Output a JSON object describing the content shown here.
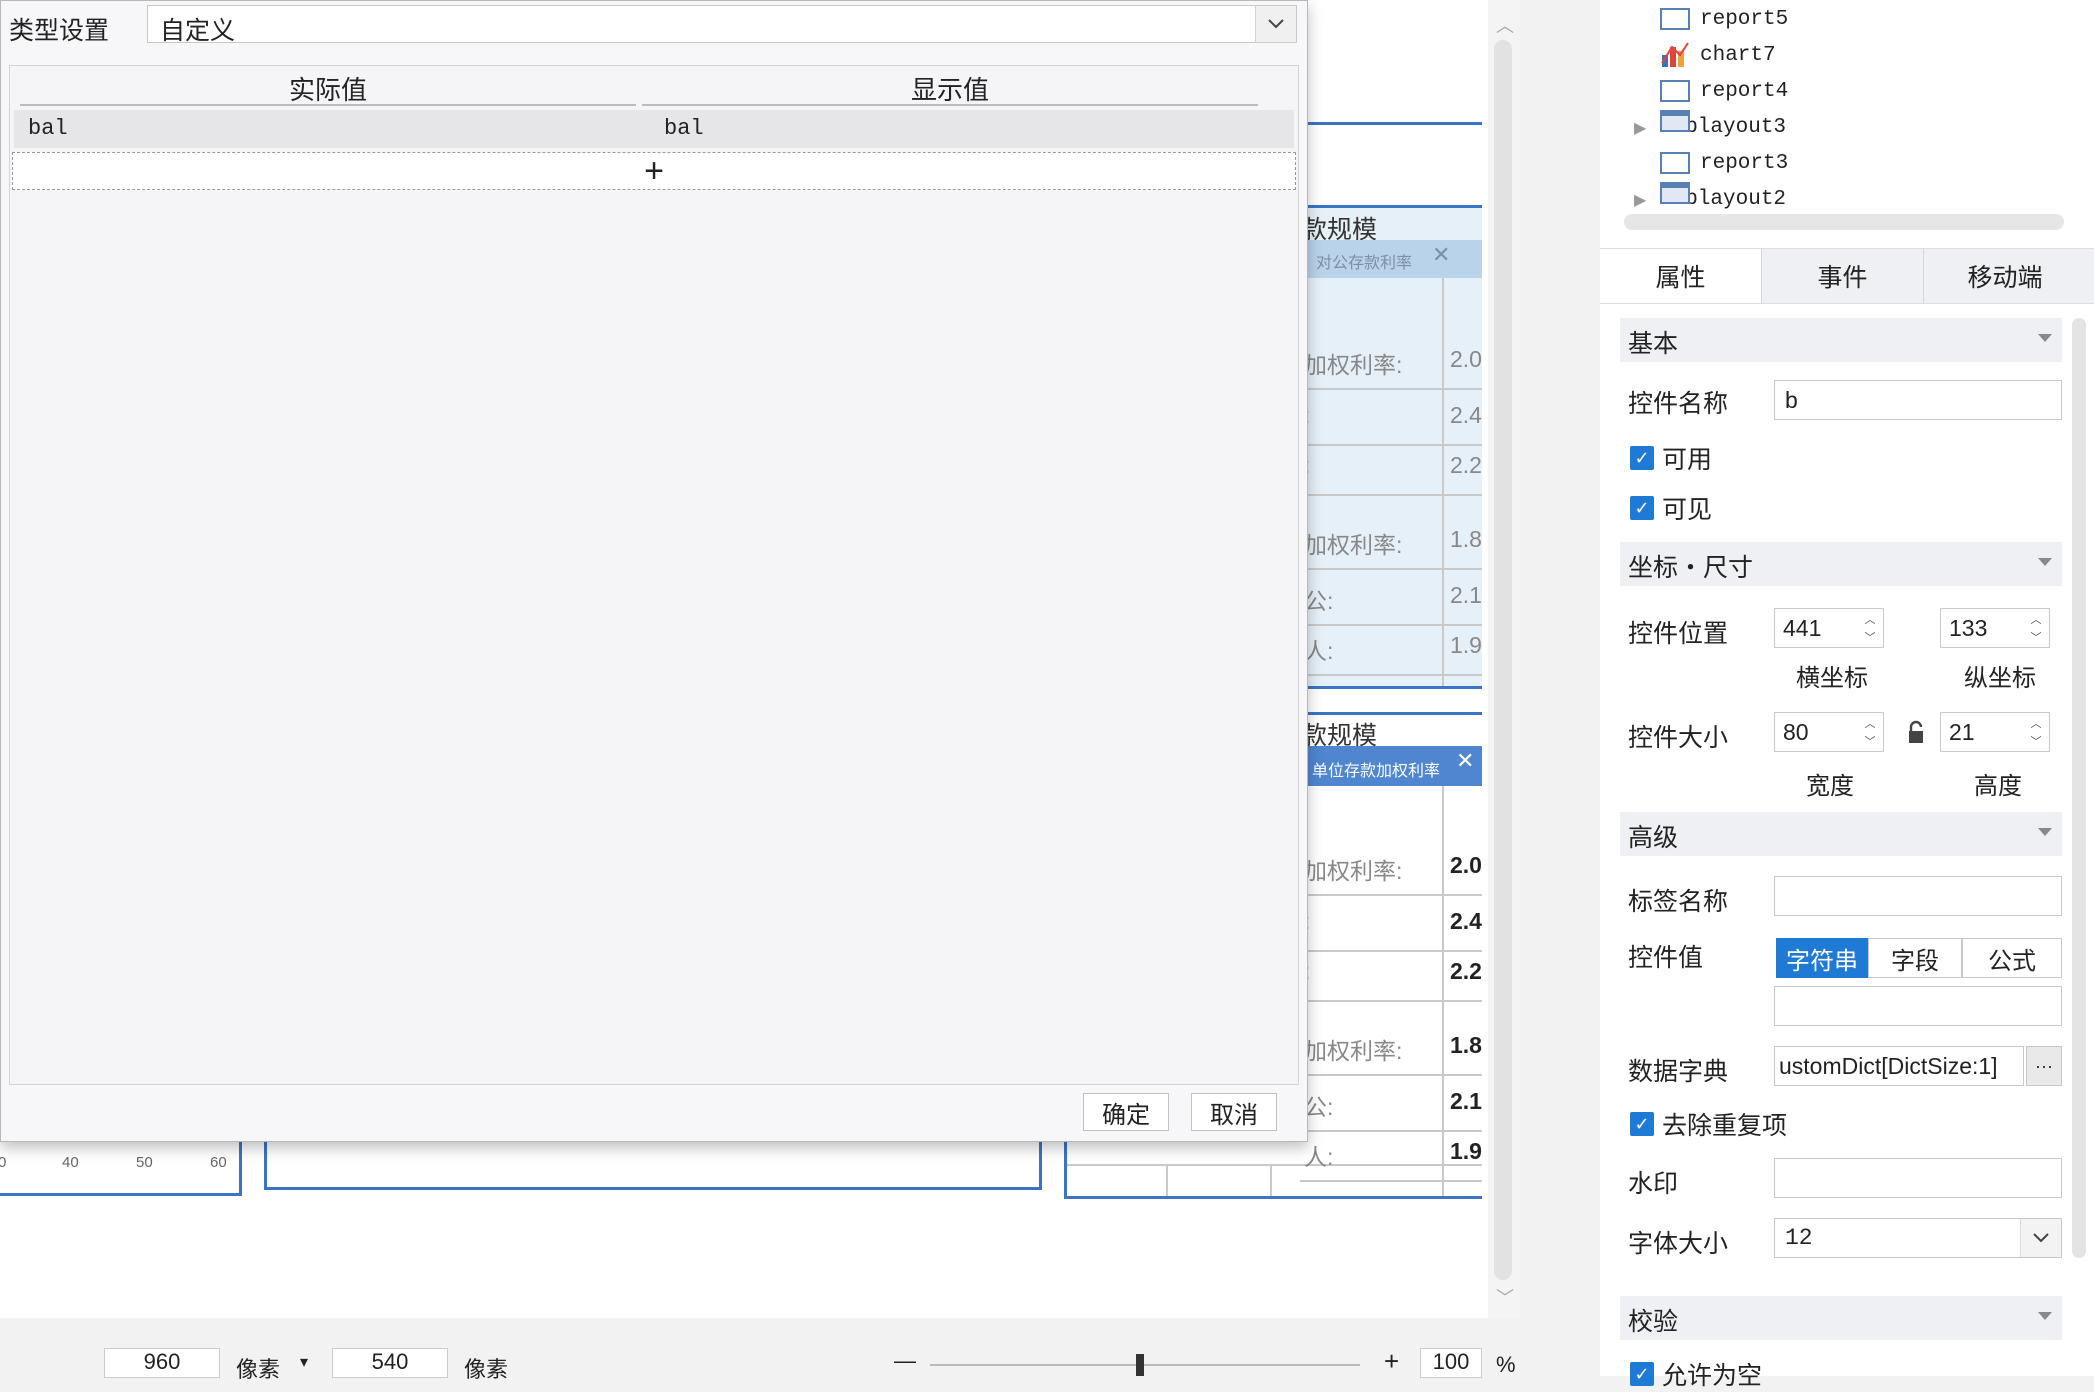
{
  "dialog": {
    "type_label": "类型设置",
    "type_value": "自定义",
    "columns": [
      "实际值",
      "显示值"
    ],
    "rows": [
      {
        "actual": "bal",
        "display": "bal"
      }
    ],
    "add_symbol": "+",
    "ok_label": "确定",
    "cancel_label": "取消"
  },
  "background_canvas": {
    "headers": [
      "款规模",
      "款规模"
    ],
    "chip1": "对公存款利率",
    "chip2": "单位存款加权利率",
    "rows_top": [
      {
        "label": "加权利率:",
        "value": "2.0"
      },
      {
        "label": ":",
        "value": "2.4"
      },
      {
        "label": ":",
        "value": "2.2"
      },
      {
        "label": "加权利率:",
        "value": "1.8"
      },
      {
        "label": "公:",
        "value": "2.1"
      },
      {
        "label": "人:",
        "value": "1.9"
      }
    ],
    "rows_bottom": [
      {
        "label": "加权利率:",
        "value": "2.0"
      },
      {
        "label": ":",
        "value": "2.4"
      },
      {
        "label": ":",
        "value": "2.2"
      },
      {
        "label": "加权利率:",
        "value": "1.8"
      },
      {
        "label": "公:",
        "value": "2.1"
      },
      {
        "label": "人:",
        "value": "1.9"
      }
    ],
    "ruler_ticks": [
      "0",
      "40",
      "50",
      "60"
    ]
  },
  "tree": {
    "items": [
      {
        "name": "report5",
        "type": "report"
      },
      {
        "name": "chart7",
        "type": "chart"
      },
      {
        "name": "report4",
        "type": "report"
      },
      {
        "name": "tablayout3",
        "type": "tab"
      },
      {
        "name": "report3",
        "type": "report"
      },
      {
        "name": "tablayout2",
        "type": "tab"
      }
    ]
  },
  "panel": {
    "tabs": [
      "属性",
      "事件",
      "移动端"
    ],
    "sections": {
      "basic": "基本",
      "coord": "坐标・尺寸",
      "advanced": "高级",
      "validate": "校验"
    },
    "name_label": "控件名称",
    "name_value": "b",
    "enabled_label": "可用",
    "visible_label": "可见",
    "position_label": "控件位置",
    "x_value": "441",
    "y_value": "133",
    "x_label": "横坐标",
    "y_label": "纵坐标",
    "size_label": "控件大小",
    "width_value": "80",
    "height_value": "21",
    "width_label": "宽度",
    "height_label": "高度",
    "tag_label": "标签名称",
    "tag_value": "",
    "value_label": "控件值",
    "value_modes": [
      "字符串",
      "字段",
      "公式"
    ],
    "value_input": "",
    "dict_label": "数据字典",
    "dict_value": "ustomDict[DictSize:1]",
    "dict_more": "···",
    "dedupe_label": "去除重复项",
    "watermark_label": "水印",
    "watermark_value": "",
    "fontsize_label": "字体大小",
    "fontsize_value": "12",
    "allow_empty_label": "允许为空"
  },
  "bottom_bar": {
    "width_value": "960",
    "unit1": "像素",
    "height_value": "540",
    "unit2": "像素",
    "zoom_value": "100",
    "zoom_unit": "%"
  }
}
